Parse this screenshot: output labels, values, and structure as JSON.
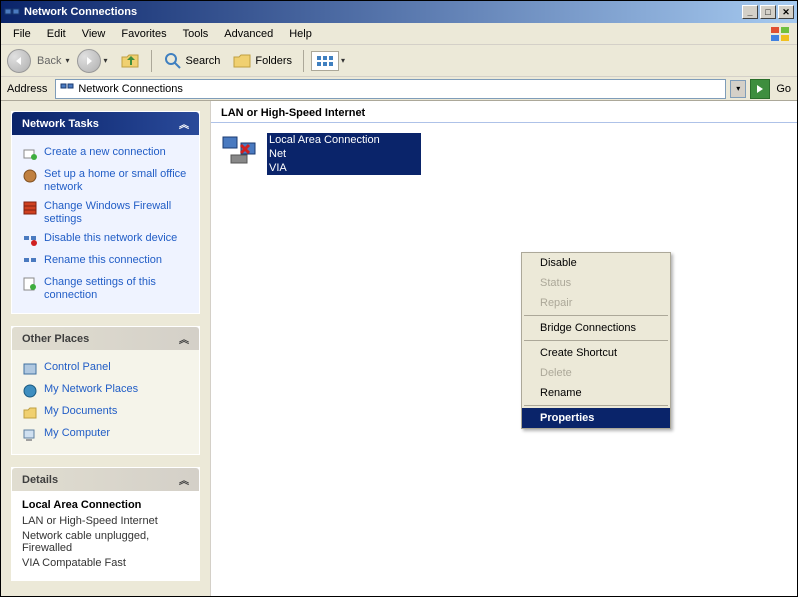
{
  "titlebar": {
    "title": "Network Connections"
  },
  "menubar": {
    "items": [
      "File",
      "Edit",
      "View",
      "Favorites",
      "Tools",
      "Advanced",
      "Help"
    ]
  },
  "toolbar": {
    "back": "Back",
    "search": "Search",
    "folders": "Folders"
  },
  "addressbar": {
    "label": "Address",
    "value": "Network Connections",
    "go": "Go"
  },
  "sidebar": {
    "network_tasks": {
      "title": "Network Tasks",
      "items": [
        "Create a new connection",
        "Set up a home or small office network",
        "Change Windows Firewall settings",
        "Disable this network device",
        "Rename this connection",
        "Change settings of this connection"
      ]
    },
    "other_places": {
      "title": "Other Places",
      "items": [
        "Control Panel",
        "My Network Places",
        "My Documents",
        "My Computer"
      ]
    },
    "details": {
      "title": "Details",
      "conn_name": "Local Area Connection",
      "conn_type": "LAN or High-Speed Internet",
      "conn_status": "Network cable unplugged, Firewalled",
      "conn_device": "VIA Compatable Fast"
    }
  },
  "main": {
    "group_header": "LAN or High-Speed Internet",
    "connection": {
      "name": "Local Area Connection",
      "status": "Net",
      "device": "VIA"
    }
  },
  "context_menu": {
    "items": [
      {
        "label": "Disable",
        "disabled": false
      },
      {
        "label": "Status",
        "disabled": true
      },
      {
        "label": "Repair",
        "disabled": true
      },
      {
        "sep": true
      },
      {
        "label": "Bridge Connections",
        "disabled": false
      },
      {
        "sep": true
      },
      {
        "label": "Create Shortcut",
        "disabled": false
      },
      {
        "label": "Delete",
        "disabled": true
      },
      {
        "label": "Rename",
        "disabled": false
      },
      {
        "sep": true
      },
      {
        "label": "Properties",
        "disabled": false,
        "selected": true
      }
    ]
  }
}
